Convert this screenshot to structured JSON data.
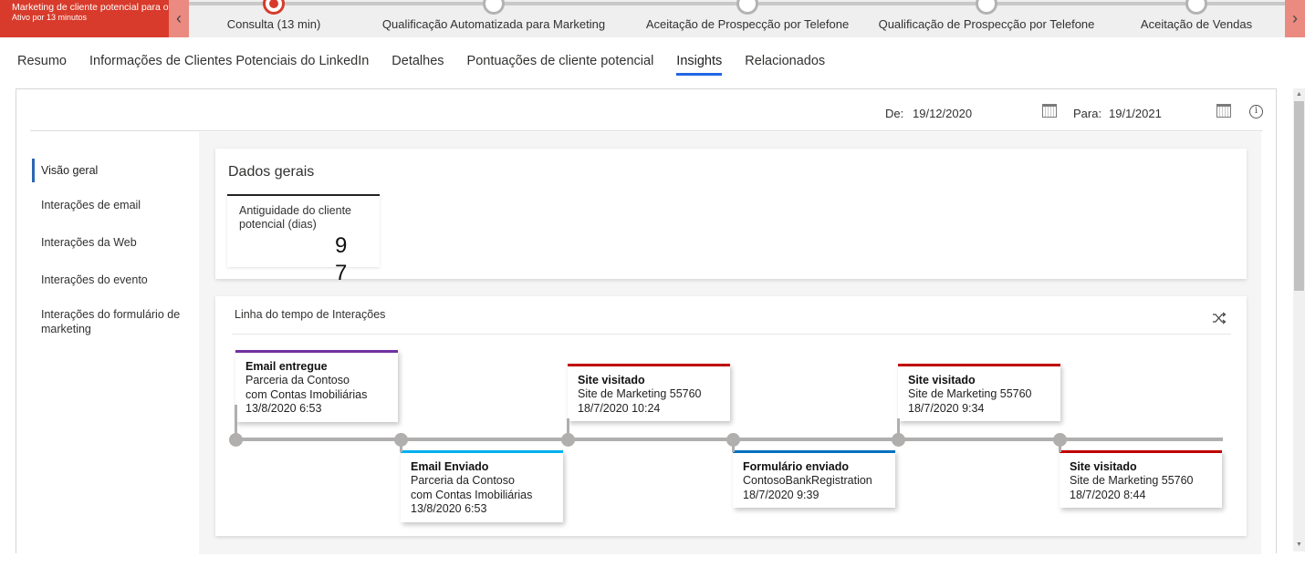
{
  "process_bar": {
    "active_stage_title": "Marketing de cliente potencial para oportunidade...",
    "active_duration": "Ativo por 13 minutos",
    "prev_icon": "chevron-left-icon",
    "next_icon": "chevron-right-icon",
    "prev_glyph": "‹",
    "next_glyph": "›",
    "stages": [
      {
        "label": "Consulta (13 min)",
        "status": "active"
      },
      {
        "label": "Qualificação Automatizada para Marketing",
        "status": "inactive"
      },
      {
        "label": "Aceitação de Prospecção por Telefone",
        "status": "inactive"
      },
      {
        "label": "Qualificação de Prospecção por Telefone",
        "status": "inactive"
      },
      {
        "label": "Aceitação de Vendas",
        "status": "inactive"
      }
    ],
    "accent_color": "#d83b2b"
  },
  "tabs": [
    {
      "label": "Resumo",
      "active": false
    },
    {
      "label": "Informações de Clientes Potenciais do LinkedIn",
      "active": false
    },
    {
      "label": "Detalhes",
      "active": false
    },
    {
      "label": "Pontuações de cliente potencial",
      "active": false
    },
    {
      "label": "Insights",
      "active": true
    },
    {
      "label": "Relacionados",
      "active": false
    }
  ],
  "date_range": {
    "from_label": "De:",
    "from_value": "19/12/2020",
    "to_label": "Para:",
    "to_value": "19/1/2021",
    "info_glyph": "i"
  },
  "left_nav": {
    "items": [
      {
        "label": "Visão geral",
        "active": true
      },
      {
        "label": "Interações de email",
        "active": false
      },
      {
        "label": "Interações da Web",
        "active": false
      },
      {
        "label": "Interações do evento",
        "active": false
      },
      {
        "label": "Interações do formulário de marketing",
        "active": false
      }
    ]
  },
  "overview": {
    "title": "Dados gerais",
    "tiles": [
      {
        "label": "Antiguidade do cliente potencial (dias)",
        "value": "97"
      }
    ]
  },
  "timeline": {
    "title": "Linha do tempo de Interações",
    "events": [
      {
        "title": "Email entregue",
        "lines": [
          "Parceria da Contoso",
          "com Contas Imobiliárias",
          "13/8/2020 6:53"
        ],
        "color": "#7030a0",
        "position": "above"
      },
      {
        "title": "Email Enviado",
        "lines": [
          "Parceria da Contoso",
          "com Contas Imobiliárias",
          "13/8/2020 6:53"
        ],
        "color": "#00b0f0",
        "position": "below"
      },
      {
        "title": "Site visitado",
        "lines": [
          "Site de Marketing 55760",
          "18/7/2020 10:24"
        ],
        "color": "#c00000",
        "position": "above"
      },
      {
        "title": "Formulário enviado",
        "lines": [
          "ContosoBankRegistration",
          "18/7/2020 9:39"
        ],
        "color": "#0070c0",
        "position": "below"
      },
      {
        "title": "Site visitado",
        "lines": [
          "Site de Marketing 55760",
          "18/7/2020 9:34"
        ],
        "color": "#c00000",
        "position": "above"
      },
      {
        "title": "Site visitado",
        "lines": [
          "Site de Marketing 55760",
          "18/7/2020 8:44"
        ],
        "color": "#c00000",
        "position": "below"
      }
    ]
  },
  "scrollbar": {
    "up_glyph": "▲",
    "down_glyph": "▼"
  }
}
